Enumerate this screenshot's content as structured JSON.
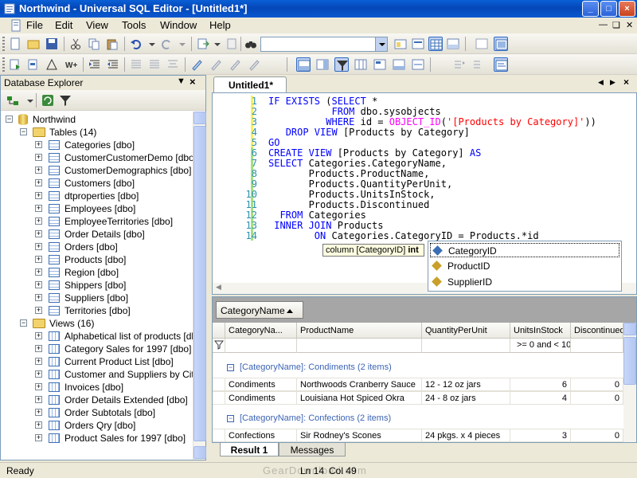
{
  "window": {
    "title": "Northwind - Universal SQL Editor - [Untitled1*]",
    "controls": {
      "minimize": "_",
      "maximize": "□",
      "close": "×"
    }
  },
  "menu": {
    "items": [
      "File",
      "Edit",
      "View",
      "Tools",
      "Window",
      "Help"
    ]
  },
  "search_combo": {
    "value": ""
  },
  "explorer": {
    "title": "Database Explorer",
    "tree": {
      "root": "Northwind",
      "tables_folder": "Tables (14)",
      "tables": [
        "Categories [dbo]",
        "CustomerCustomerDemo [dbo]",
        "CustomerDemographics [dbo]",
        "Customers [dbo]",
        "dtproperties [dbo]",
        "Employees [dbo]",
        "EmployeeTerritories [dbo]",
        "Order Details [dbo]",
        "Orders [dbo]",
        "Products [dbo]",
        "Region [dbo]",
        "Shippers [dbo]",
        "Suppliers [dbo]",
        "Territories [dbo]"
      ],
      "views_folder": "Views (16)",
      "views": [
        "Alphabetical list of products [dbo]",
        "Category Sales for 1997 [dbo]",
        "Current Product List [dbo]",
        "Customer and Suppliers by City [dbo]",
        "Invoices [dbo]",
        "Order Details Extended [dbo]",
        "Order Subtotals [dbo]",
        "Orders Qry [dbo]",
        "Product Sales for 1997 [dbo]"
      ]
    }
  },
  "editor": {
    "tab_label": "Untitled1*",
    "line_numbers": [
      "1",
      "2",
      "3",
      "4",
      "5",
      "6",
      "7",
      "8",
      "9",
      "10",
      "11",
      "12",
      "13",
      "14"
    ],
    "lines": [
      [
        {
          "t": "kw",
          "v": "IF EXISTS"
        },
        {
          "t": "",
          "v": " ("
        },
        {
          "t": "kw",
          "v": "SELECT"
        },
        {
          "t": "",
          "v": " *"
        }
      ],
      [
        {
          "t": "",
          "v": "           "
        },
        {
          "t": "kw",
          "v": "FROM"
        },
        {
          "t": "",
          "v": " dbo.sysobjects"
        }
      ],
      [
        {
          "t": "",
          "v": "          "
        },
        {
          "t": "kw",
          "v": "WHERE"
        },
        {
          "t": "",
          "v": " id = "
        },
        {
          "t": "fn",
          "v": "OBJECT_ID"
        },
        {
          "t": "",
          "v": "("
        },
        {
          "t": "str",
          "v": "'[Products by Category]'"
        },
        {
          "t": "",
          "v": "))"
        }
      ],
      [
        {
          "t": "",
          "v": "   "
        },
        {
          "t": "kw",
          "v": "DROP VIEW"
        },
        {
          "t": "",
          "v": " [Products by Category]"
        }
      ],
      [
        {
          "t": "kw",
          "v": "GO"
        }
      ],
      [
        {
          "t": "kw",
          "v": "CREATE VIEW"
        },
        {
          "t": "",
          "v": " [Products by Category] "
        },
        {
          "t": "kw",
          "v": "AS"
        }
      ],
      [
        {
          "t": "kw",
          "v": "SELECT"
        },
        {
          "t": "",
          "v": " Categories.CategoryName,"
        }
      ],
      [
        {
          "t": "",
          "v": "       Products.ProductName,"
        }
      ],
      [
        {
          "t": "",
          "v": "       Products.QuantityPerUnit,"
        }
      ],
      [
        {
          "t": "",
          "v": "       Products.UnitsInStock,"
        }
      ],
      [
        {
          "t": "",
          "v": "       Products.Discontinued"
        }
      ],
      [
        {
          "t": "",
          "v": "  "
        },
        {
          "t": "kw",
          "v": "FROM"
        },
        {
          "t": "",
          "v": " Categories"
        }
      ],
      [
        {
          "t": "",
          "v": " "
        },
        {
          "t": "kw",
          "v": "INNER JOIN"
        },
        {
          "t": "",
          "v": " Products"
        }
      ],
      [
        {
          "t": "",
          "v": "        "
        },
        {
          "t": "kw",
          "v": "ON"
        },
        {
          "t": "",
          "v": " Categories.CategoryID = Products.*id"
        }
      ]
    ],
    "tooltip": {
      "prefix": "column [CategoryID] ",
      "type": "int"
    },
    "completion": [
      "CategoryID",
      "ProductID",
      "SupplierID"
    ]
  },
  "results": {
    "group_by_chip": "CategoryName",
    "columns": [
      "CategoryNa...",
      "ProductName",
      "QuantityPerUnit",
      "UnitsInStock",
      "Discontinued"
    ],
    "filter": {
      "units_in_stock": ">= 0 and < 10"
    },
    "groups": [
      {
        "label": "[CategoryName]: Condiments (2 items)",
        "expander": "−",
        "rows": [
          {
            "category": "Condiments",
            "product": "Northwoods Cranberry Sauce",
            "qty": "12 - 12 oz jars",
            "units": "6",
            "disc": "0"
          },
          {
            "category": "Condiments",
            "product": "Louisiana Hot Spiced Okra",
            "qty": "24 - 8 oz jars",
            "units": "4",
            "disc": "0"
          }
        ]
      },
      {
        "label": "[CategoryName]: Confections (2 items)",
        "expander": "−",
        "rows": [
          {
            "category": "Confections",
            "product": "Sir Rodney's Scones",
            "qty": "24 pkgs. x 4 pieces",
            "units": "3",
            "disc": "0"
          }
        ]
      }
    ],
    "tabs": [
      "Result 1",
      "Messages"
    ]
  },
  "status": {
    "state": "Ready",
    "line": "Ln 14",
    "col": "Col 49",
    "watermark": "GearDownload.com"
  }
}
